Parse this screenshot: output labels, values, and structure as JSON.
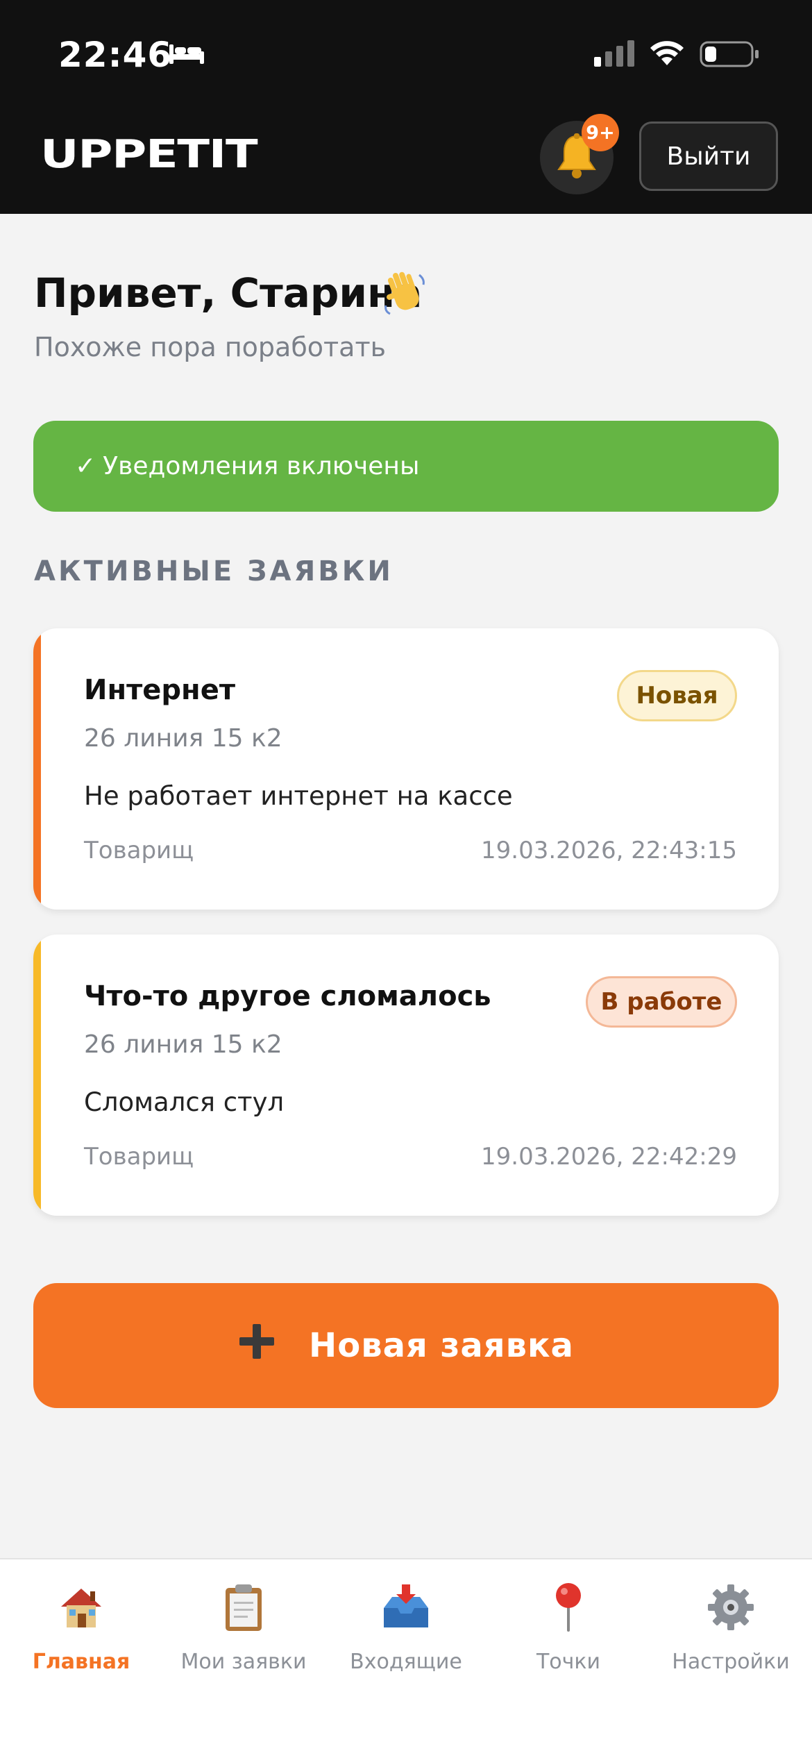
{
  "status_bar": {
    "time": "22:46"
  },
  "header": {
    "logo": "UPPETIT",
    "bell_badge": "9+",
    "logout_label": "Выйти"
  },
  "greeting": {
    "title": "Привет, Старина",
    "subtitle": "Похоже пора поработать"
  },
  "notification_banner": {
    "check": "✓",
    "text": "Уведомления включены",
    "color": "#65b544"
  },
  "section_title": "АКТИВНЫЕ ЗАЯВКИ",
  "tickets": [
    {
      "title": "Интернет",
      "address": "26 линия 15 к2",
      "description": "Не работает интернет на кассе",
      "author": "Товарищ",
      "datetime": "19.03.2026, 22:43:15",
      "status": "Новая",
      "stripe_color": "#f47324",
      "badge_bg": "#fdf3d6",
      "badge_border": "#f3d88a",
      "badge_text_color": "#7a5200"
    },
    {
      "title": "Что-то другое сломалось",
      "address": "26 линия 15 к2",
      "description": "Сломался стул",
      "author": "Товарищ",
      "datetime": "19.03.2026, 22:42:29",
      "status": "В работе",
      "stripe_color": "#f7b928",
      "badge_bg": "#fde4d6",
      "badge_border": "#f4b897",
      "badge_text_color": "#8a3a08"
    }
  ],
  "new_ticket_button": {
    "plus": "+",
    "label": "Новая заявка",
    "color": "#f47324"
  },
  "tabbar": {
    "items": [
      {
        "label": "Главная",
        "icon": "house-icon",
        "active": true
      },
      {
        "label": "Мои заявки",
        "icon": "clipboard-icon",
        "active": false
      },
      {
        "label": "Входящие",
        "icon": "inbox-tray-icon",
        "active": false
      },
      {
        "label": "Точки",
        "icon": "pushpin-icon",
        "active": false
      },
      {
        "label": "Настройки",
        "icon": "gear-icon",
        "active": false
      }
    ]
  }
}
